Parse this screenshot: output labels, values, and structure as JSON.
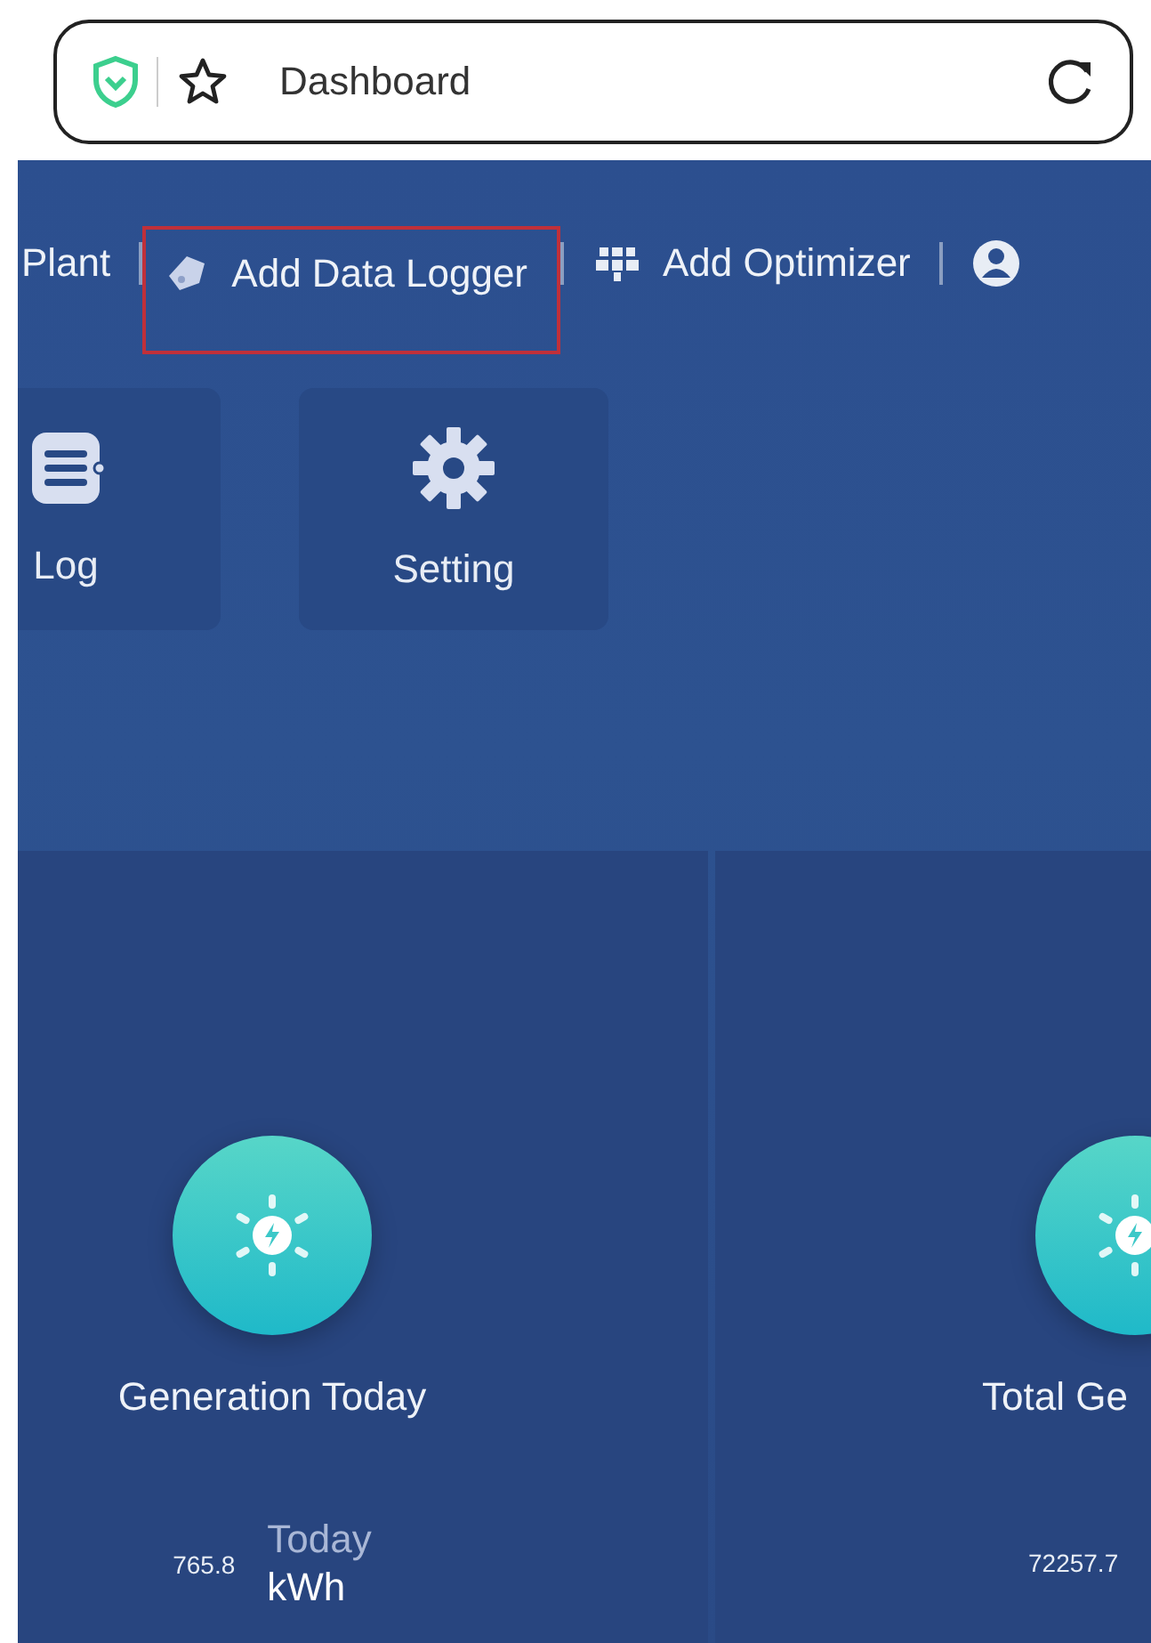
{
  "address_bar": {
    "title": "Dashboard"
  },
  "nav": [
    {
      "kind": "text",
      "label": "Plant",
      "highlighted": false
    },
    {
      "kind": "logger",
      "label": "Add Data Logger",
      "highlighted": true
    },
    {
      "kind": "optimizer",
      "label": "Add Optimizer",
      "highlighted": false
    },
    {
      "kind": "user",
      "highlighted": false
    }
  ],
  "tiles": [
    {
      "kind": "log",
      "label": "Log"
    },
    {
      "kind": "gear",
      "label": "Setting"
    }
  ],
  "cards": [
    {
      "title": "Generation Today",
      "value": "765.8",
      "period": "Today",
      "unit": "kWh"
    },
    {
      "title": "Total Ge",
      "value": "72257.7"
    }
  ]
}
